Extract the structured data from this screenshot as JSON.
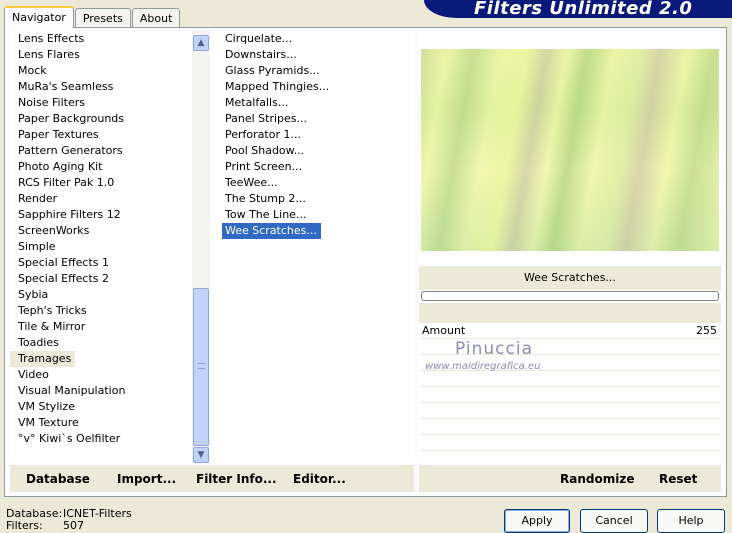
{
  "tabs": [
    {
      "label": "Navigator"
    },
    {
      "label": "Presets"
    },
    {
      "label": "About"
    }
  ],
  "logo": "Filters Unlimited 2.0",
  "categories": [
    "Lens Effects",
    "Lens Flares",
    "Mock",
    "MuRa's Seamless",
    "Noise Filters",
    "Paper Backgrounds",
    "Paper Textures",
    "Pattern Generators",
    "Photo Aging Kit",
    "RCS Filter Pak 1.0",
    "Render",
    "Sapphire Filters 12",
    "ScreenWorks",
    "Simple",
    "Special Effects 1",
    "Special Effects 2",
    "Sybia",
    "Teph's Tricks",
    "Tile & Mirror",
    "Toadies",
    "Tramages",
    "Video",
    "Visual Manipulation",
    "VM Stylize",
    "VM Texture",
    "°v° Kiwi`s Oelfilter"
  ],
  "selected_category": "Tramages",
  "filters": [
    "Cirquelate...",
    "Downstairs...",
    "Glass Pyramids...",
    "Mapped Thingies...",
    "Metalfalls...",
    "Panel Stripes...",
    "Perforator 1...",
    "Pool Shadow...",
    "Print Screen...",
    "TeeWee...",
    "The Stump 2...",
    "Tow The Line...",
    "Wee Scratches..."
  ],
  "selected_filter": "Wee Scratches...",
  "preview_filter_name": "Wee Scratches...",
  "params": [
    {
      "name": "Amount",
      "value": "255"
    }
  ],
  "watermark": {
    "line1": "Pinuccia",
    "line2": "www.maidiregrafica.eu"
  },
  "toolbar": {
    "database": "Database",
    "import": "Import...",
    "filter_info": "Filter Info...",
    "editor": "Editor...",
    "randomize": "Randomize",
    "reset": "Reset"
  },
  "status": {
    "database_label": "Database:",
    "database_value": "ICNET-Filters",
    "filters_label": "Filters:",
    "filters_value": "507"
  },
  "buttons": {
    "apply": "Apply",
    "cancel": "Cancel",
    "help": "Help"
  }
}
